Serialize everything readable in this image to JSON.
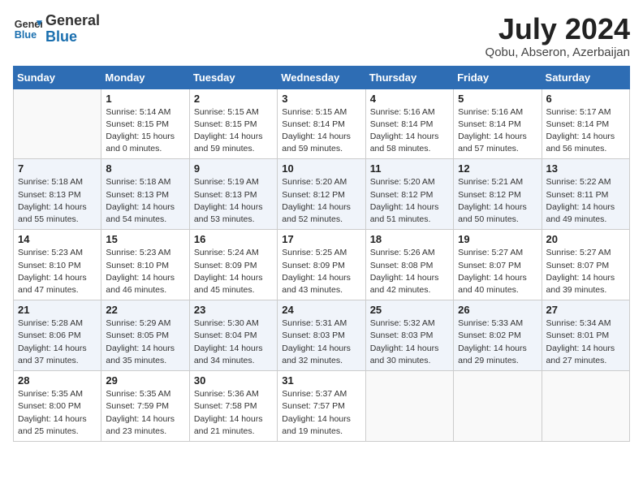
{
  "header": {
    "logo_line1": "General",
    "logo_line2": "Blue",
    "month_year": "July 2024",
    "location": "Qobu, Abseron, Azerbaijan"
  },
  "weekdays": [
    "Sunday",
    "Monday",
    "Tuesday",
    "Wednesday",
    "Thursday",
    "Friday",
    "Saturday"
  ],
  "weeks": [
    [
      {
        "day": "",
        "info": ""
      },
      {
        "day": "1",
        "info": "Sunrise: 5:14 AM\nSunset: 8:15 PM\nDaylight: 15 hours\nand 0 minutes."
      },
      {
        "day": "2",
        "info": "Sunrise: 5:15 AM\nSunset: 8:15 PM\nDaylight: 14 hours\nand 59 minutes."
      },
      {
        "day": "3",
        "info": "Sunrise: 5:15 AM\nSunset: 8:14 PM\nDaylight: 14 hours\nand 59 minutes."
      },
      {
        "day": "4",
        "info": "Sunrise: 5:16 AM\nSunset: 8:14 PM\nDaylight: 14 hours\nand 58 minutes."
      },
      {
        "day": "5",
        "info": "Sunrise: 5:16 AM\nSunset: 8:14 PM\nDaylight: 14 hours\nand 57 minutes."
      },
      {
        "day": "6",
        "info": "Sunrise: 5:17 AM\nSunset: 8:14 PM\nDaylight: 14 hours\nand 56 minutes."
      }
    ],
    [
      {
        "day": "7",
        "info": "Sunrise: 5:18 AM\nSunset: 8:13 PM\nDaylight: 14 hours\nand 55 minutes."
      },
      {
        "day": "8",
        "info": "Sunrise: 5:18 AM\nSunset: 8:13 PM\nDaylight: 14 hours\nand 54 minutes."
      },
      {
        "day": "9",
        "info": "Sunrise: 5:19 AM\nSunset: 8:13 PM\nDaylight: 14 hours\nand 53 minutes."
      },
      {
        "day": "10",
        "info": "Sunrise: 5:20 AM\nSunset: 8:12 PM\nDaylight: 14 hours\nand 52 minutes."
      },
      {
        "day": "11",
        "info": "Sunrise: 5:20 AM\nSunset: 8:12 PM\nDaylight: 14 hours\nand 51 minutes."
      },
      {
        "day": "12",
        "info": "Sunrise: 5:21 AM\nSunset: 8:12 PM\nDaylight: 14 hours\nand 50 minutes."
      },
      {
        "day": "13",
        "info": "Sunrise: 5:22 AM\nSunset: 8:11 PM\nDaylight: 14 hours\nand 49 minutes."
      }
    ],
    [
      {
        "day": "14",
        "info": "Sunrise: 5:23 AM\nSunset: 8:10 PM\nDaylight: 14 hours\nand 47 minutes."
      },
      {
        "day": "15",
        "info": "Sunrise: 5:23 AM\nSunset: 8:10 PM\nDaylight: 14 hours\nand 46 minutes."
      },
      {
        "day": "16",
        "info": "Sunrise: 5:24 AM\nSunset: 8:09 PM\nDaylight: 14 hours\nand 45 minutes."
      },
      {
        "day": "17",
        "info": "Sunrise: 5:25 AM\nSunset: 8:09 PM\nDaylight: 14 hours\nand 43 minutes."
      },
      {
        "day": "18",
        "info": "Sunrise: 5:26 AM\nSunset: 8:08 PM\nDaylight: 14 hours\nand 42 minutes."
      },
      {
        "day": "19",
        "info": "Sunrise: 5:27 AM\nSunset: 8:07 PM\nDaylight: 14 hours\nand 40 minutes."
      },
      {
        "day": "20",
        "info": "Sunrise: 5:27 AM\nSunset: 8:07 PM\nDaylight: 14 hours\nand 39 minutes."
      }
    ],
    [
      {
        "day": "21",
        "info": "Sunrise: 5:28 AM\nSunset: 8:06 PM\nDaylight: 14 hours\nand 37 minutes."
      },
      {
        "day": "22",
        "info": "Sunrise: 5:29 AM\nSunset: 8:05 PM\nDaylight: 14 hours\nand 35 minutes."
      },
      {
        "day": "23",
        "info": "Sunrise: 5:30 AM\nSunset: 8:04 PM\nDaylight: 14 hours\nand 34 minutes."
      },
      {
        "day": "24",
        "info": "Sunrise: 5:31 AM\nSunset: 8:03 PM\nDaylight: 14 hours\nand 32 minutes."
      },
      {
        "day": "25",
        "info": "Sunrise: 5:32 AM\nSunset: 8:03 PM\nDaylight: 14 hours\nand 30 minutes."
      },
      {
        "day": "26",
        "info": "Sunrise: 5:33 AM\nSunset: 8:02 PM\nDaylight: 14 hours\nand 29 minutes."
      },
      {
        "day": "27",
        "info": "Sunrise: 5:34 AM\nSunset: 8:01 PM\nDaylight: 14 hours\nand 27 minutes."
      }
    ],
    [
      {
        "day": "28",
        "info": "Sunrise: 5:35 AM\nSunset: 8:00 PM\nDaylight: 14 hours\nand 25 minutes."
      },
      {
        "day": "29",
        "info": "Sunrise: 5:35 AM\nSunset: 7:59 PM\nDaylight: 14 hours\nand 23 minutes."
      },
      {
        "day": "30",
        "info": "Sunrise: 5:36 AM\nSunset: 7:58 PM\nDaylight: 14 hours\nand 21 minutes."
      },
      {
        "day": "31",
        "info": "Sunrise: 5:37 AM\nSunset: 7:57 PM\nDaylight: 14 hours\nand 19 minutes."
      },
      {
        "day": "",
        "info": ""
      },
      {
        "day": "",
        "info": ""
      },
      {
        "day": "",
        "info": ""
      }
    ]
  ]
}
